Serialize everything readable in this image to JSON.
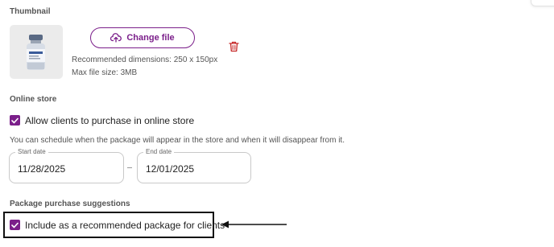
{
  "thumbnail": {
    "heading": "Thumbnail",
    "change_button_label": "Change file",
    "recommended_dimensions": "Recommended dimensions: 250 x 150px",
    "max_file_size": "Max file size: 3MB"
  },
  "online_store": {
    "heading": "Online store",
    "allow_purchase_label": "Allow clients to purchase in online store",
    "allow_purchase_checked": true,
    "schedule_hint": "You can schedule when the package will appear in the store and when it will disappear from it.",
    "start_date": {
      "label": "Start date",
      "value": "11/28/2025"
    },
    "end_date": {
      "label": "End date",
      "value": "12/01/2025"
    }
  },
  "purchase_suggestions": {
    "heading": "Package purchase suggestions",
    "recommend_label": "Include as a recommended package for clients",
    "recommend_checked": true
  },
  "colors": {
    "accent": "#7b1f8a",
    "delete": "#c62828"
  }
}
